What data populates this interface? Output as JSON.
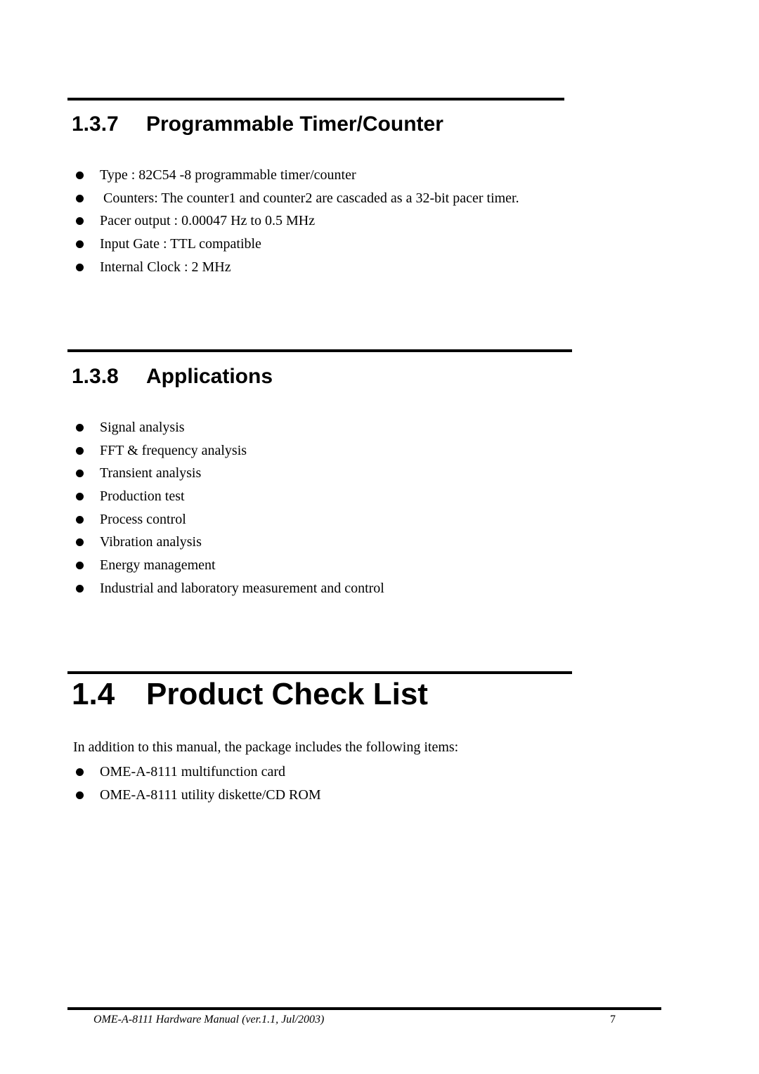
{
  "sections": [
    {
      "number": "1.3.7",
      "title": "Programmable Timer/Counter",
      "items": [
        "Type : 82C54 -8 programmable timer/counter",
        " Counters: The counter1 and counter2 are cascaded as a 32-bit pacer timer.",
        "Pacer output : 0.00047 Hz to 0.5 MHz",
        "Input Gate : TTL compatible",
        "Internal Clock : 2 MHz"
      ]
    },
    {
      "number": "1.3.8",
      "title": "Applications",
      "items": [
        "Signal analysis",
        "FFT & frequency analysis",
        "Transient analysis",
        "Production test",
        "Process control",
        "Vibration analysis",
        "Energy management",
        "Industrial and laboratory measurement and control"
      ]
    },
    {
      "number": "1.4",
      "title": "Product Check List",
      "intro": "In addition to this manual, the package includes the following items:",
      "items": [
        "OME-A-8111 multifunction card",
        "OME-A-8111 utility diskette/CD ROM"
      ]
    }
  ],
  "footer": {
    "title": "OME-A-8111 Hardware Manual (ver.1.1, Jul/2003)",
    "page_number": "7"
  }
}
